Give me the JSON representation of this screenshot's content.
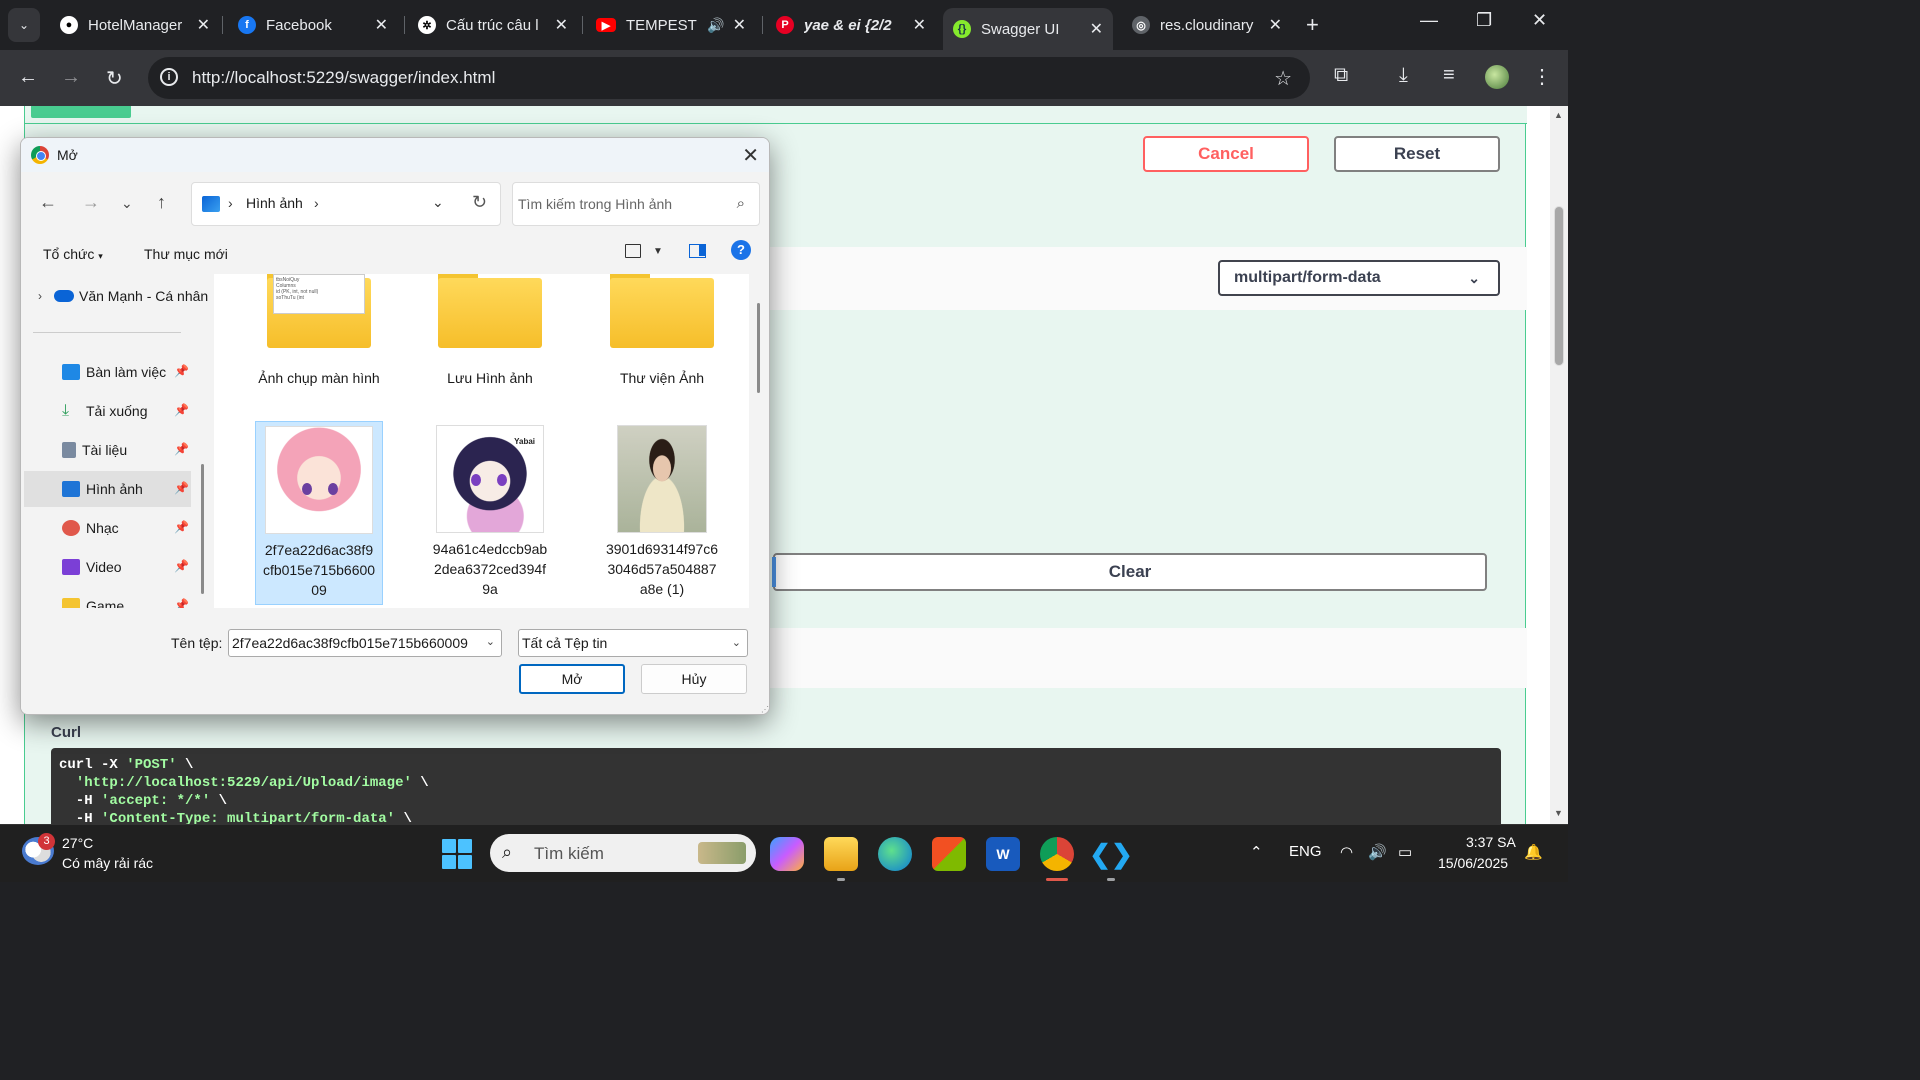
{
  "browser": {
    "tabs": [
      {
        "title": "HotelManager",
        "icon": "github-icon",
        "active": false
      },
      {
        "title": "Facebook",
        "icon": "facebook-icon",
        "active": false
      },
      {
        "title": "Cấu trúc câu l",
        "icon": "chatgpt-icon",
        "active": false
      },
      {
        "title": "TEMPEST",
        "icon": "youtube-icon",
        "active": false
      },
      {
        "title": "yae & ei {2/2",
        "icon": "pinterest-icon",
        "active": false
      },
      {
        "title": "Swagger UI",
        "icon": "swagger-icon",
        "active": true
      },
      {
        "title": "res.cloudinary",
        "icon": "globe-icon",
        "active": false
      }
    ],
    "url": "http://localhost:5229/swagger/index.html"
  },
  "swagger": {
    "cancel_label": "Cancel",
    "reset_label": "Reset",
    "content_type": "multipart/form-data",
    "clear_label": "Clear",
    "curl_label": "Curl",
    "curl_lines": [
      {
        "pre": "curl -X ",
        "str": "'POST'",
        "post": " \\"
      },
      {
        "pre": "  ",
        "str": "'http://localhost:5229/api/Upload/image'",
        "post": " \\"
      },
      {
        "pre": "  -H ",
        "str": "'accept: */*'",
        "post": " \\"
      },
      {
        "pre": "  -H ",
        "str": "'Content-Type: multipart/form-data'",
        "post": " \\"
      }
    ]
  },
  "dialog": {
    "title": "Mở",
    "breadcrumb": "Hình ảnh",
    "search_placeholder": "Tìm kiếm trong Hình ảnh",
    "organize_label": "Tổ chức",
    "new_folder_label": "Thư mục mới",
    "onedrive_label": "Văn Mạnh - Cá nhân",
    "sidebar": [
      {
        "label": "Bàn làm việc",
        "icon": "desktop-icon",
        "color": "#1e88e5",
        "selected": false
      },
      {
        "label": "Tải xuống",
        "icon": "download-icon",
        "color": "#2e9e5b",
        "selected": false
      },
      {
        "label": "Tài liệu",
        "icon": "document-icon",
        "color": "#7a8aa0",
        "selected": false
      },
      {
        "label": "Hình ảnh",
        "icon": "pictures-icon",
        "color": "#1e74d6",
        "selected": true
      },
      {
        "label": "Nhạc",
        "icon": "music-icon",
        "color": "#e0584b",
        "selected": false
      },
      {
        "label": "Video",
        "icon": "video-icon",
        "color": "#7b3fd6",
        "selected": false
      },
      {
        "label": "Game",
        "icon": "folder-icon",
        "color": "#f4c430",
        "selected": false
      }
    ],
    "files": [
      {
        "name": "Ảnh chụp màn hình",
        "kind": "folder"
      },
      {
        "name": "Lưu Hình ảnh",
        "kind": "folder"
      },
      {
        "name": "Thư viện Ảnh",
        "kind": "folder"
      },
      {
        "name": "2f7ea22d6ac38f9cfb015e715b660009",
        "kind": "image",
        "selected": true
      },
      {
        "name": "94a61c4edccb9ab2dea6372ced394f9a",
        "kind": "image"
      },
      {
        "name": "3901d69314f97c63046d57a504887a8e (1)",
        "kind": "image"
      }
    ],
    "folder_preview_lines": [
      "tbsNoiQuy",
      "Columns",
      "id (PK, int, not null)",
      "soThuTu (int"
    ],
    "raiden_thumb_text": "Yabai",
    "filename_label": "Tên tệp:",
    "filename_value": "2f7ea22d6ac38f9cfb015e715b660009",
    "filetype_value": "Tất cả Tệp tin",
    "open_label": "Mở",
    "cancel_label": "Hủy"
  },
  "taskbar": {
    "weather_temp": "27°C",
    "weather_desc": "Có mây rải rác",
    "weather_badge": "3",
    "search_label": "Tìm kiếm",
    "lang": "ENG",
    "time": "3:37 SA",
    "date": "15/06/2025"
  }
}
